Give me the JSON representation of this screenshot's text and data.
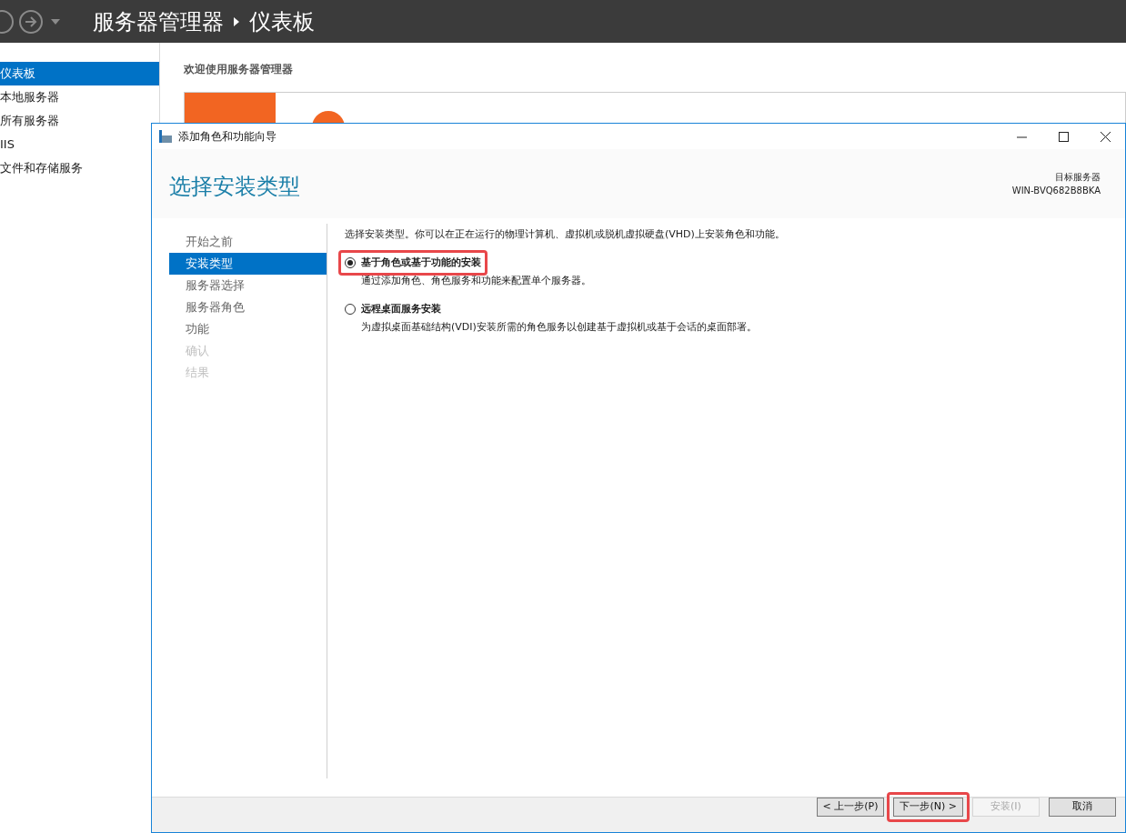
{
  "app": {
    "title": "服务器管理器",
    "page": "仪表板"
  },
  "sidebar": {
    "items": [
      {
        "label": "仪表板",
        "selected": true
      },
      {
        "label": "本地服务器",
        "selected": false
      },
      {
        "label": "所有服务器",
        "selected": false
      },
      {
        "label": "IIS",
        "selected": false
      },
      {
        "label": "文件和存储服务",
        "selected": false
      }
    ]
  },
  "main": {
    "welcome": "欢迎使用服务器管理器"
  },
  "dialog": {
    "title": "添加角色和功能向导",
    "heading": "选择安装类型",
    "target_label": "目标服务器",
    "target_name": "WIN-BVQ682B8BKA",
    "steps": [
      {
        "label": "开始之前",
        "selected": false,
        "disabled": false
      },
      {
        "label": "安装类型",
        "selected": true,
        "disabled": false
      },
      {
        "label": "服务器选择",
        "selected": false,
        "disabled": false
      },
      {
        "label": "服务器角色",
        "selected": false,
        "disabled": false
      },
      {
        "label": "功能",
        "selected": false,
        "disabled": false
      },
      {
        "label": "确认",
        "selected": false,
        "disabled": true
      },
      {
        "label": "结果",
        "selected": false,
        "disabled": true
      }
    ],
    "intro": "选择安装类型。你可以在正在运行的物理计算机、虚拟机或脱机虚拟硬盘(VHD)上安装角色和功能。",
    "options": [
      {
        "label": "基于角色或基于功能的安装",
        "description": "通过添加角色、角色服务和功能来配置单个服务器。",
        "selected": true,
        "highlighted": true
      },
      {
        "label": "远程桌面服务安装",
        "description": "为虚拟桌面基础结构(VDI)安装所需的角色服务以创建基于虚拟机或基于会话的桌面部署。",
        "selected": false,
        "highlighted": false
      }
    ],
    "buttons": [
      {
        "label": "< 上一步(P)",
        "disabled": false,
        "highlighted": false
      },
      {
        "label": "下一步(N) >",
        "disabled": false,
        "highlighted": true
      },
      {
        "label": "安装(I)",
        "disabled": true,
        "highlighted": false
      },
      {
        "label": "取消",
        "disabled": false,
        "highlighted": false
      }
    ]
  }
}
